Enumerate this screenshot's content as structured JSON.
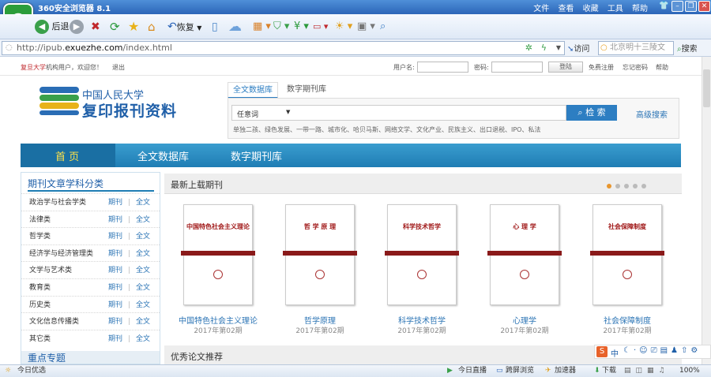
{
  "titlebar": {
    "title": "360安全浏览器 8.1",
    "menu": [
      "文件",
      "查看",
      "收藏",
      "工具",
      "帮助"
    ]
  },
  "toolbar": {
    "back": "后退",
    "restore": "恢复"
  },
  "addressbar": {
    "url_prefix": "http://ipub.",
    "url_domain": "exuezhe.com",
    "url_suffix": "/index.html",
    "go": "访问",
    "search_placeholder": "北京明十三陵文",
    "search_button": "搜索"
  },
  "topbar": {
    "org": "复旦大学",
    "welcome": "机构用户，欢迎您！",
    "logout": "退出",
    "username_label": "用户名:",
    "password_label": "密码:",
    "login": "登陆",
    "register": "免费注册",
    "forgot": "忘记密码",
    "help": "帮助"
  },
  "brand": {
    "line1": "中国人民大学",
    "line2": "复印报刊资料"
  },
  "search": {
    "tabs": [
      "全文数据库",
      "数字期刊库"
    ],
    "field": "任意词",
    "button": "检 索",
    "advanced": "高级搜索",
    "hot_terms": "单独二孩、绿色发展、一带一路、城市化、哈贝马斯、网络文学、文化产业、民族主义、出口退税、IPO、私法"
  },
  "nav": {
    "items": [
      "首 页",
      "全文数据库",
      "数字期刊库"
    ]
  },
  "sidebar": {
    "title": "期刊文章学科分类",
    "journal": "期刊",
    "fulltext": "全文",
    "sep": "|",
    "categories": [
      "政治学与社会学类",
      "法律类",
      "哲学类",
      "经济学与经济管理类",
      "文学与艺术类",
      "教育类",
      "历史类",
      "文化信息传播类",
      "其它类"
    ],
    "next_title": "重点专题"
  },
  "gallery": {
    "title": "最新上载期刊",
    "issues": [
      {
        "cover": "中国特色社会主义理论",
        "title": "中国特色社会主义理论",
        "issue": "2017年第02期"
      },
      {
        "cover": "哲 学 原 理",
        "title": "哲学原理",
        "issue": "2017年第02期"
      },
      {
        "cover": "科学技术哲学",
        "title": "科学技术哲学",
        "issue": "2017年第02期"
      },
      {
        "cover": "心 理 学",
        "title": "心理学",
        "issue": "2017年第02期"
      },
      {
        "cover": "社会保障制度",
        "title": "社会保障制度",
        "issue": "2017年第02期"
      }
    ]
  },
  "recommend": {
    "title": "优秀论文推荐"
  },
  "ime": {
    "lang": "中"
  },
  "statusbar": {
    "left": "今日优选",
    "live": "今日直播",
    "cross": "跨屏浏览",
    "speed": "加速器",
    "download": "下载",
    "zoom": "100%"
  },
  "colors": {
    "nav": "#1f7db4",
    "brand": "#1f5fa8",
    "link": "#2b74b5",
    "search_button": "#2d7ec2",
    "accent_red": "#c0282d"
  }
}
